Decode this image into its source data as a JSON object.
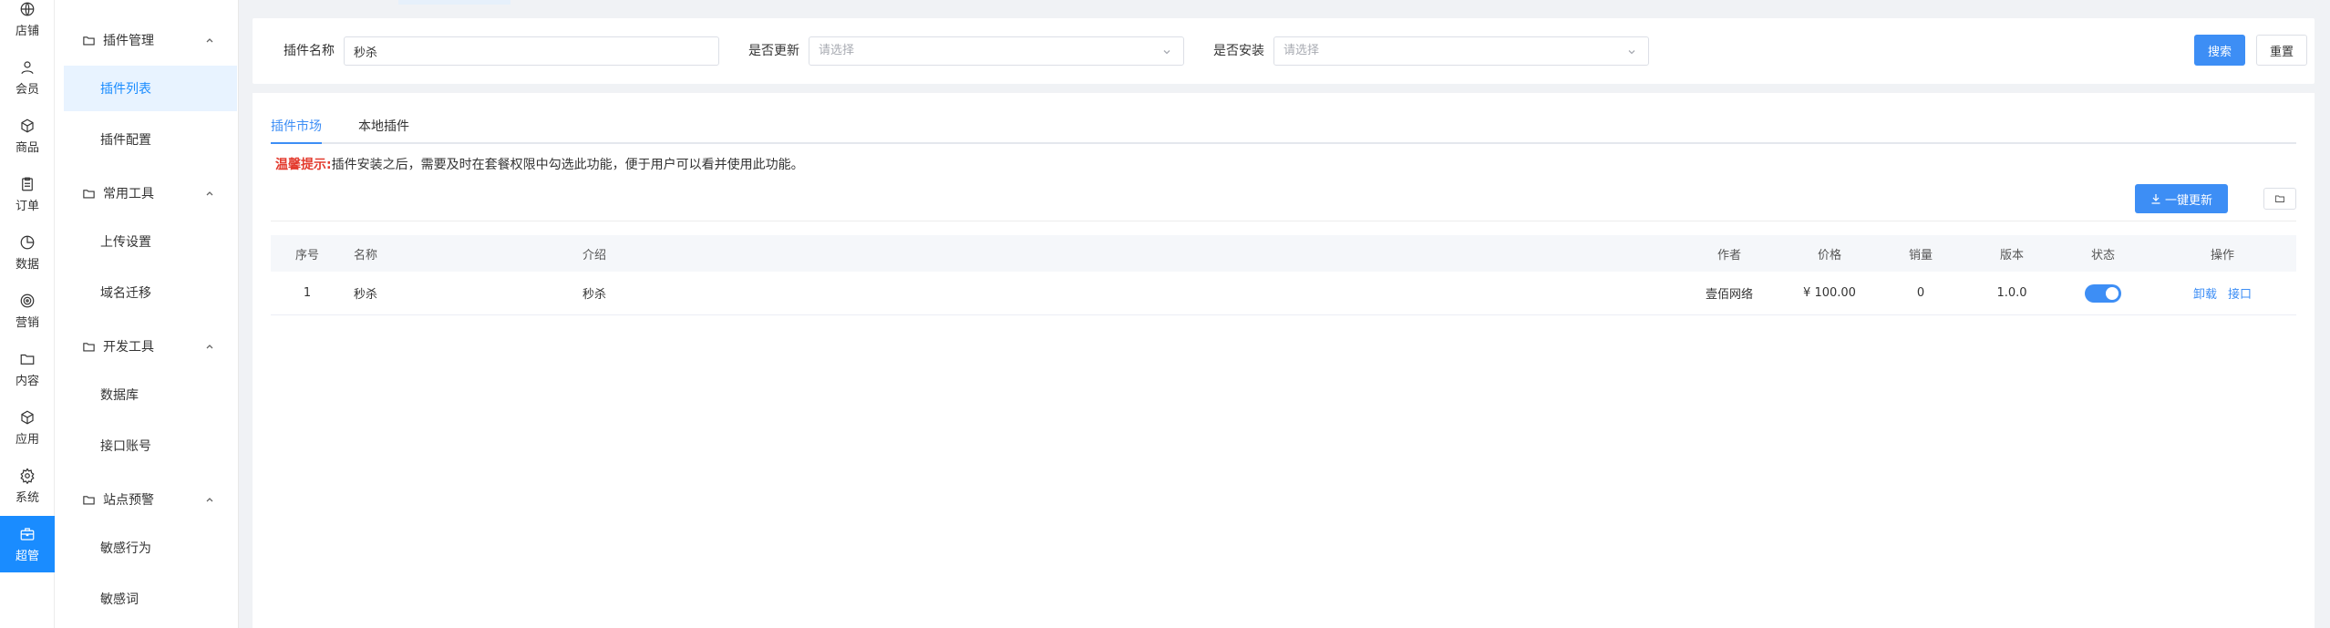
{
  "rail": {
    "items": [
      {
        "label": "店铺",
        "icon": "globe-icon"
      },
      {
        "label": "会员",
        "icon": "user-icon"
      },
      {
        "label": "商品",
        "icon": "cube-icon"
      },
      {
        "label": "订单",
        "icon": "clipboard-icon"
      },
      {
        "label": "数据",
        "icon": "pie-chart-icon"
      },
      {
        "label": "营销",
        "icon": "target-icon"
      },
      {
        "label": "内容",
        "icon": "folder-icon"
      },
      {
        "label": "应用",
        "icon": "box-icon"
      },
      {
        "label": "系统",
        "icon": "gear-icon"
      },
      {
        "label": "超管",
        "icon": "briefcase-icon"
      }
    ],
    "active": "超管",
    "active_color": "#1a8cff"
  },
  "submenu": {
    "groups": [
      {
        "title": "插件管理",
        "items": [
          "插件列表",
          "插件配置"
        ]
      },
      {
        "title": "常用工具",
        "items": [
          "上传设置",
          "域名迁移"
        ]
      },
      {
        "title": "开发工具",
        "items": [
          "数据库",
          "接口账号"
        ]
      },
      {
        "title": "站点预警",
        "items": [
          "敏感行为",
          "敏感词"
        ]
      }
    ],
    "active_item": "插件列表"
  },
  "search": {
    "name_label": "插件名称",
    "name_value": "秒杀",
    "update_label": "是否更新",
    "update_placeholder": "请选择",
    "install_label": "是否安装",
    "install_placeholder": "请选择",
    "search_button": "搜索",
    "reset_button": "重置"
  },
  "tabs": {
    "market": "插件市场",
    "local": "本地插件",
    "active": "插件市场"
  },
  "tip": {
    "title": "温馨提示:",
    "text": "插件安装之后，需要及时在套餐权限中勾选此功能，便于用户可以看并使用此功能。"
  },
  "toolbar": {
    "update_all": "一键更新"
  },
  "table": {
    "columns": {
      "index": "序号",
      "name": "名称",
      "intro": "介绍",
      "author": "作者",
      "price": "价格",
      "sales": "销量",
      "version": "版本",
      "status": "状态",
      "actions": "操作"
    },
    "rows": [
      {
        "index": "1",
        "name": "秒杀",
        "intro": "秒杀",
        "author": "壹佰网络",
        "price": "¥ 100.00",
        "sales": "0",
        "version": "1.0.0",
        "status_on": true,
        "action_uninstall": "卸载",
        "action_api": "接口"
      }
    ]
  },
  "colors": {
    "primary": "#3d8ef5",
    "warning_text": "#e33b2e"
  }
}
